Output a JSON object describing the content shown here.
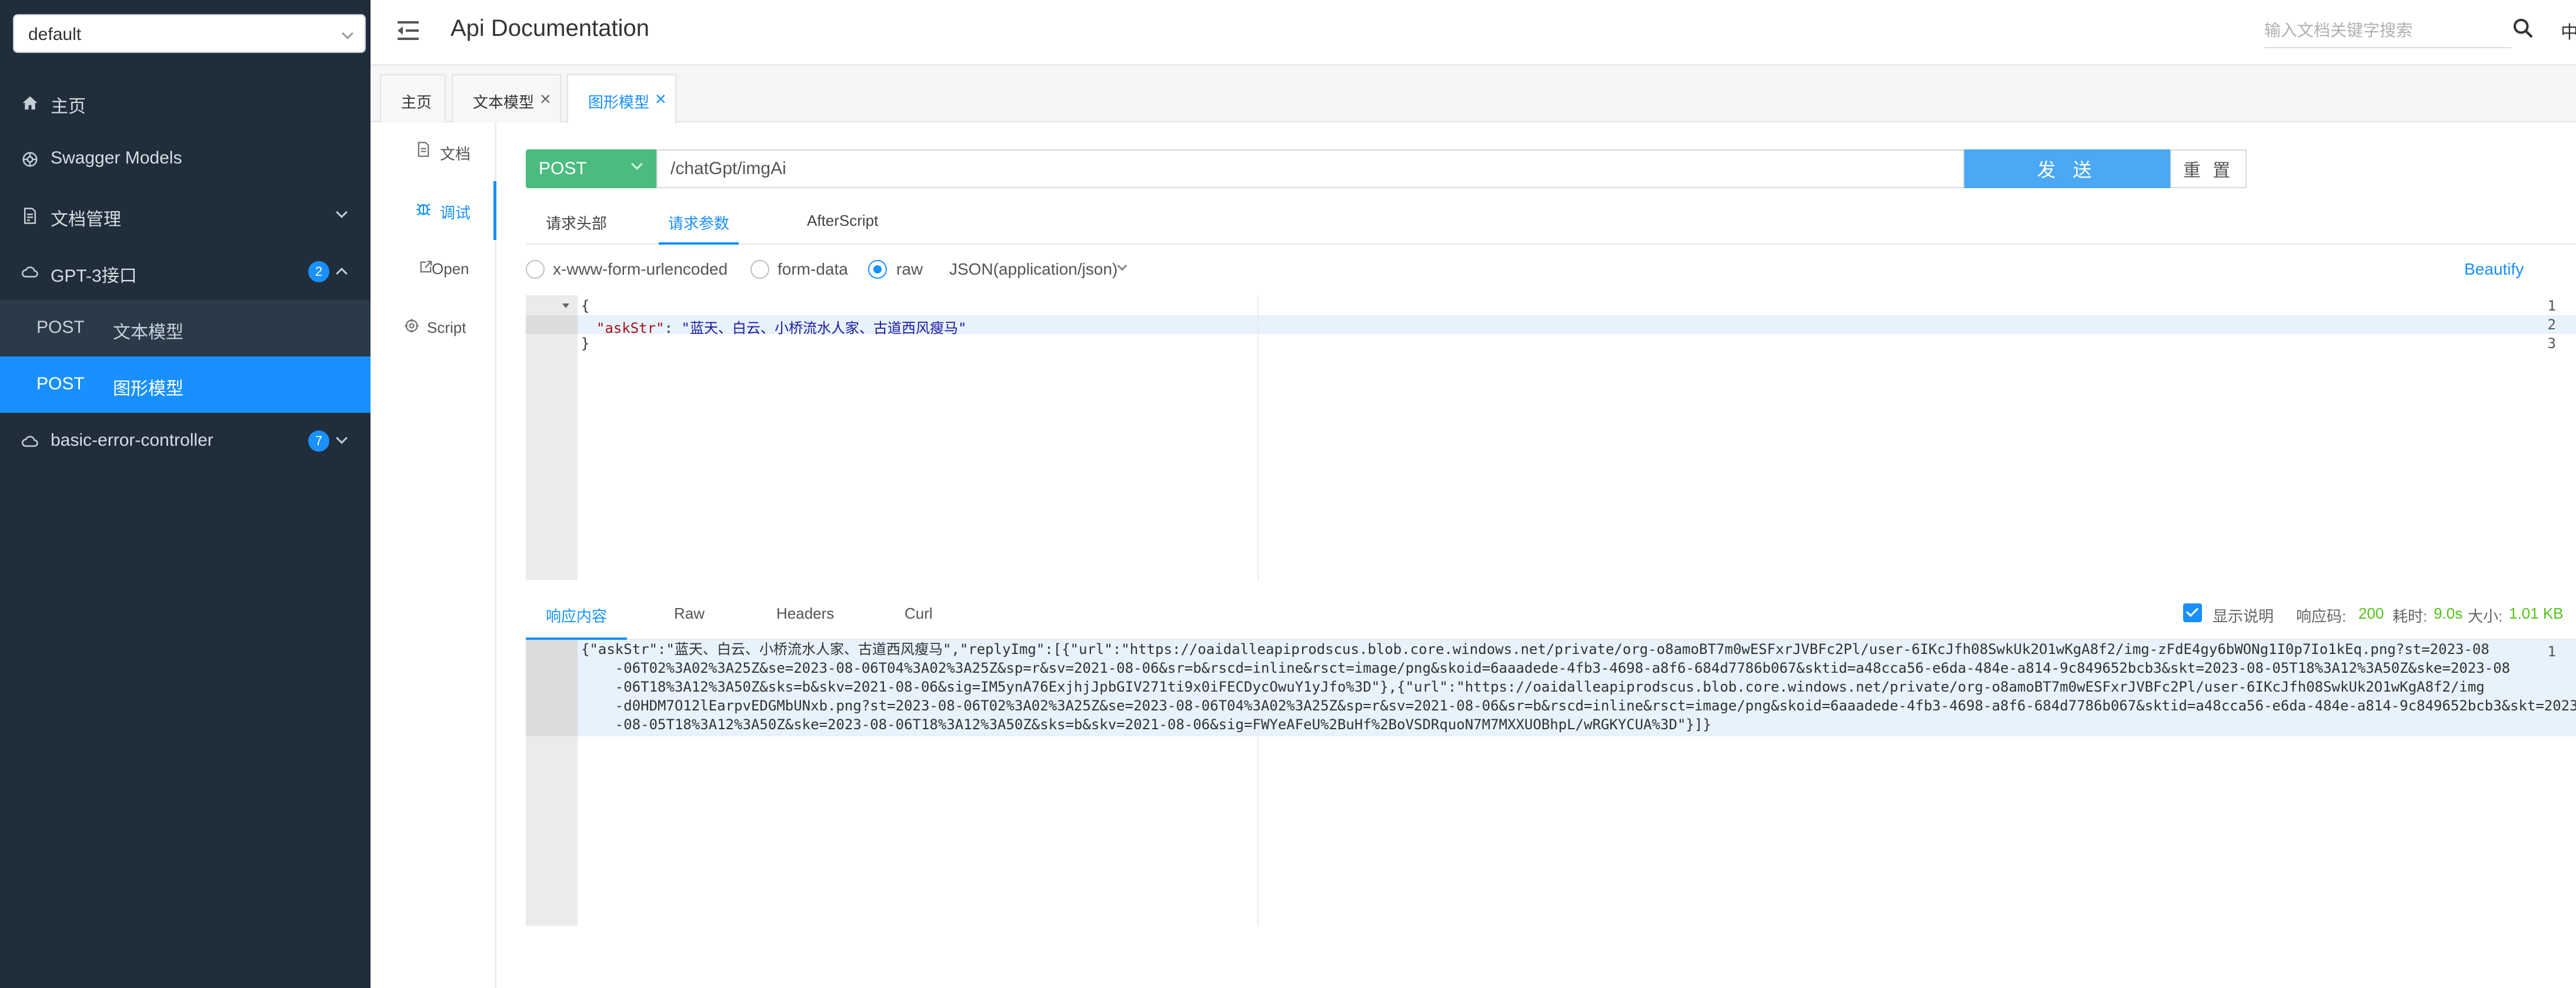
{
  "sidebar": {
    "group_select": "default",
    "items": [
      {
        "label": "主页",
        "icon": "home-icon"
      },
      {
        "label": "Swagger Models",
        "icon": "cube-icon"
      },
      {
        "label": "文档管理",
        "icon": "doc-manage-icon"
      },
      {
        "label": "GPT-3接口",
        "icon": "cloud-icon",
        "badge": "2"
      },
      {
        "label": "basic-error-controller",
        "icon": "cloud-icon",
        "badge": "7"
      }
    ],
    "sub_items": [
      {
        "method": "POST",
        "label": "文本模型"
      },
      {
        "method": "POST",
        "label": "图形模型"
      }
    ]
  },
  "header": {
    "title": "Api Documentation",
    "search_placeholder": "输入文档关键字搜索",
    "lang": "中"
  },
  "tabs": [
    {
      "label": "主页"
    },
    {
      "label": "文本模型"
    },
    {
      "label": "图形模型"
    }
  ],
  "subnav": [
    {
      "label": "文档",
      "icon": "document-icon"
    },
    {
      "label": "调试",
      "icon": "debug-icon"
    },
    {
      "label": "Open",
      "icon": "open-icon"
    },
    {
      "label": "Script",
      "icon": "script-icon"
    }
  ],
  "request": {
    "method": "POST",
    "url": "/chatGpt/imgAi",
    "send_label": "发 送",
    "reset_label": "重 置",
    "tabs": [
      "请求头部",
      "请求参数",
      "AfterScript"
    ],
    "body_types": [
      "x-www-form-urlencoded",
      "form-data",
      "raw"
    ],
    "content_type": "JSON(application/json)",
    "beautify": "Beautify",
    "code": {
      "line1": "{",
      "key": "\"askStr\"",
      "colon": ": ",
      "value": "\"蓝天、白云、小桥流水人家、古道西风瘦马\"",
      "line3": "}"
    }
  },
  "response": {
    "tabs": [
      "响应内容",
      "Raw",
      "Headers",
      "Curl"
    ],
    "show_desc": "显示说明",
    "code_label": "响应码:",
    "code_value": "200",
    "time_label": "耗时:",
    "time_value": "9.0s",
    "size_label": "大小:",
    "size_value": "1.01 KB",
    "lines": [
      "{\"askStr\":\"蓝天、白云、小桥流水人家、古道西风瘦马\",\"replyImg\":[{\"url\":\"https://oaidalleapiprodscus.blob.core.windows.net/private/org-o8amoBT7m0wESFxrJVBFc2Pl/user-6IKcJfh08SwkUk2O1wKgA8f2/img-zFdE4gy6bWONg1I0p7Io1kEq.png?st=2023-08",
      "    -06T02%3A02%3A25Z&se=2023-08-06T04%3A02%3A25Z&sp=r&sv=2021-08-06&sr=b&rscd=inline&rsct=image/png&skoid=6aaadede-4fb3-4698-a8f6-684d7786b067&sktid=a48cca56-e6da-484e-a814-9c849652bcb3&skt=2023-08-05T18%3A12%3A50Z&ske=2023-08",
      "    -06T18%3A12%3A50Z&sks=b&skv=2021-08-06&sig=IM5ynA76ExjhjJpbGIV271ti9x0iFECDycOwuY1yJfo%3D\"},{\"url\":\"https://oaidalleapiprodscus.blob.core.windows.net/private/org-o8amoBT7m0wESFxrJVBFc2Pl/user-6IKcJfh08SwkUk2O1wKgA8f2/img",
      "    -d0HDM7O12lEarpvEDGMbUNxb.png?st=2023-08-06T02%3A02%3A25Z&se=2023-08-06T04%3A02%3A25Z&sp=r&sv=2021-08-06&sr=b&rscd=inline&rsct=image/png&skoid=6aaadede-4fb3-4698-a8f6-684d7786b067&sktid=a48cca56-e6da-484e-a814-9c849652bcb3&skt=2023",
      "    -08-05T18%3A12%3A50Z&ske=2023-08-06T18%3A12%3A50Z&sks=b&skv=2021-08-06&sig=FWYeAFeU%2BuHf%2BoVSDRquoN7M7MXXUOBhpL/wRGKYCUA%3D\"}]}"
    ]
  },
  "colors": {
    "sidebar_bg": "#202d3a",
    "accent": "#1890ff",
    "method_post": "#4cbb7f",
    "send_button": "#4aa8f5",
    "status_ok": "#52c41a"
  }
}
